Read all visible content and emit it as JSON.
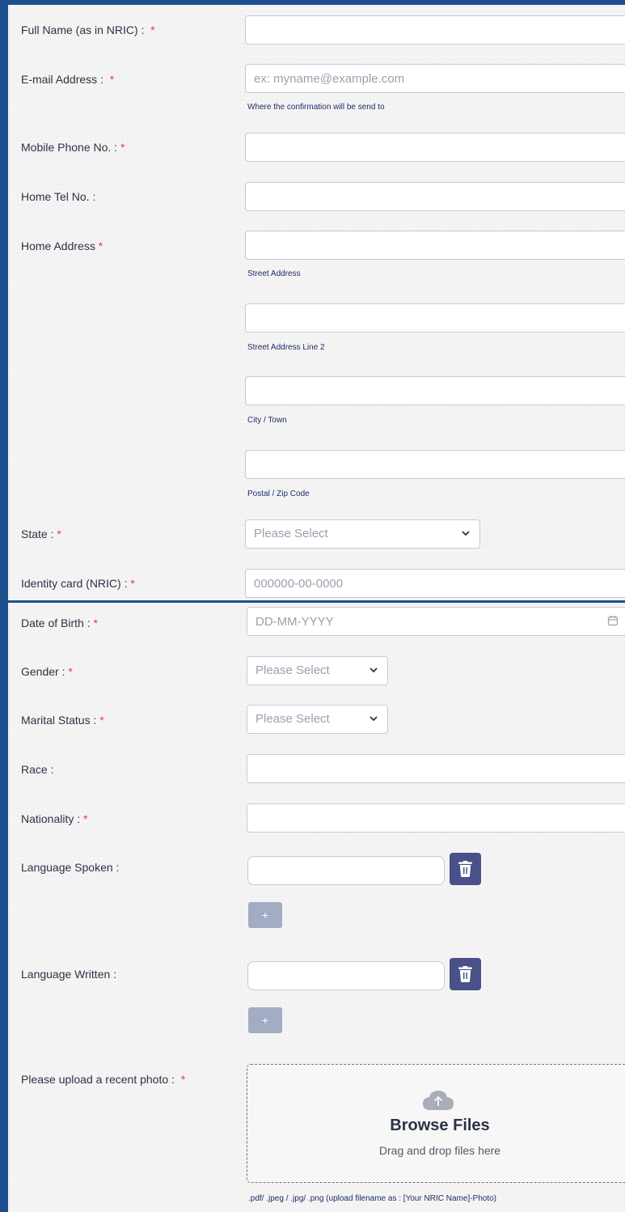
{
  "form": {
    "full_name": {
      "label": "Full Name (as in NRIC) :",
      "req": "*"
    },
    "email": {
      "label": "E-mail Address :",
      "req": "*",
      "placeholder": "ex: myname@example.com",
      "sublabel": "Where the confirmation will be send to"
    },
    "mobile": {
      "label": "Mobile Phone No. :",
      "req": "*"
    },
    "home_tel": {
      "label": "Home Tel No. :"
    },
    "address": {
      "label": "Home Address",
      "req": "*",
      "street_label": "Street Address",
      "street2_label": "Street Address Line 2",
      "city_label": "City / Town",
      "postal_label": "Postal / Zip Code"
    },
    "state": {
      "label": "State :",
      "req": "*",
      "value": "Please Select"
    },
    "nric": {
      "label": "Identity card (NRIC) :",
      "req": "*",
      "placeholder": "000000-00-0000"
    },
    "dob": {
      "label": "Date of Birth :",
      "req": "*",
      "placeholder": "DD-MM-YYYY"
    },
    "gender": {
      "label": "Gender :",
      "req": "*",
      "value": "Please Select"
    },
    "marital": {
      "label": "Marital Status :",
      "req": "*",
      "value": "Please Select"
    },
    "race": {
      "label": "Race :"
    },
    "nationality": {
      "label": "Nationality :",
      "req": "*"
    },
    "lang_spoken": {
      "label": "Language Spoken :",
      "add": "+"
    },
    "lang_written": {
      "label": "Language Written :",
      "add": "+"
    },
    "photo": {
      "label": "Please upload a recent photo :",
      "req": "*",
      "browse": "Browse Files",
      "drag": "Drag and drop files here",
      "hint": ".pdf/ .jpeg / .jpg/ .png (upload filename as : [Your NRIC Name]-Photo)"
    }
  },
  "colors": {
    "frame": "#1d4f8e",
    "button": "#4a5088",
    "add_button": "#a3acc2",
    "required": "#e0403b",
    "sublabel": "#1f2d6a"
  },
  "icons": {
    "trash": "trash-icon",
    "chevron": "chevron-down-icon",
    "calendar": "calendar-icon",
    "upload": "cloud-upload-icon"
  }
}
